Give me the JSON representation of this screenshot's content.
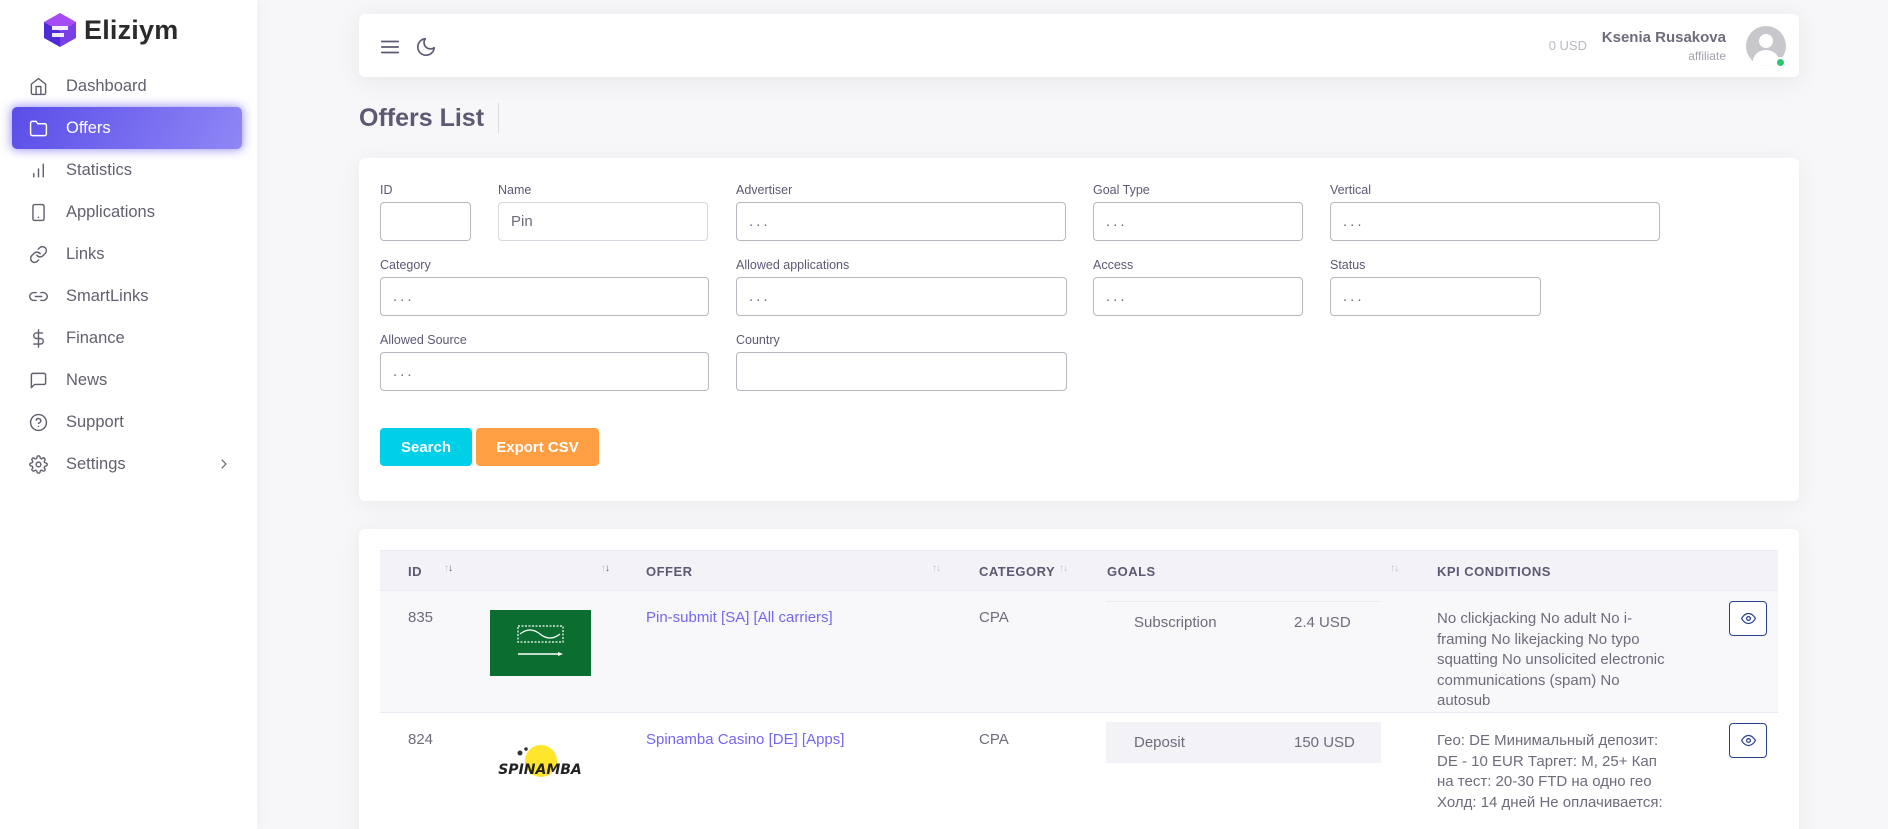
{
  "brand": {
    "name": "Eliziym",
    "colors": {
      "primary": "#7367f0",
      "logo_a": "#4d2bd8",
      "logo_b": "#a64bf4"
    }
  },
  "sidebar": {
    "items": [
      {
        "label": "Dashboard",
        "icon": "home-icon",
        "active": false
      },
      {
        "label": "Offers",
        "icon": "folder-icon",
        "active": true
      },
      {
        "label": "Statistics",
        "icon": "bar-chart-icon",
        "active": false
      },
      {
        "label": "Applications",
        "icon": "smartphone-icon",
        "active": false
      },
      {
        "label": "Links",
        "icon": "link-icon",
        "active": false
      },
      {
        "label": "SmartLinks",
        "icon": "link-2-icon",
        "active": false
      },
      {
        "label": "Finance",
        "icon": "dollar-icon",
        "active": false
      },
      {
        "label": "News",
        "icon": "message-square-icon",
        "active": false
      },
      {
        "label": "Support",
        "icon": "help-circle-icon",
        "active": false
      },
      {
        "label": "Settings",
        "icon": "settings-icon",
        "active": false,
        "has_submenu": true
      }
    ]
  },
  "topbar": {
    "balance": "0 USD",
    "user_name": "Ksenia Rusakova",
    "user_role": "affiliate",
    "status": "online"
  },
  "page": {
    "title": "Offers List"
  },
  "filters": {
    "id": {
      "label": "ID",
      "value": ""
    },
    "name": {
      "label": "Name",
      "value": "Pin"
    },
    "advertiser": {
      "label": "Advertiser",
      "placeholder": "..."
    },
    "goal_type": {
      "label": "Goal Type",
      "placeholder": "..."
    },
    "vertical": {
      "label": "Vertical",
      "placeholder": "..."
    },
    "category": {
      "label": "Category",
      "placeholder": "..."
    },
    "allowed_applications": {
      "label": "Allowed applications",
      "placeholder": "..."
    },
    "access": {
      "label": "Access",
      "placeholder": "..."
    },
    "status": {
      "label": "Status",
      "placeholder": "..."
    },
    "allowed_source": {
      "label": "Allowed Source",
      "placeholder": "..."
    },
    "country": {
      "label": "Country",
      "value": ""
    },
    "search_label": "Search",
    "export_label": "Export CSV"
  },
  "table": {
    "headers": {
      "id": "ID",
      "offer": "OFFER",
      "category": "CATEGORY",
      "goals": "GOALS",
      "kpi": "KPI CONDITIONS"
    },
    "rows": [
      {
        "id": "835",
        "image": "saudi-arabia-flag",
        "offer": "Pin-submit [SA] [All carriers]",
        "category": "CPA",
        "goal_name": "Subscription",
        "goal_payout": "2.4 USD",
        "kpi": "No clickjacking No adult No i-framing No likejacking No typo squatting No unsolicited electronic communications (spam) No autosub"
      },
      {
        "id": "824",
        "image": "spinamba-logo",
        "offer": "Spinamba Casino [DE] [Apps]",
        "category": "CPA",
        "goal_name": "Deposit",
        "goal_payout": "150 USD",
        "kpi": "Гео: DE Минимальный депозит: DE - 10 EUR Таргет: M, 25+ Кап на тест: 20-30 FTD на одно гео Холд: 14 дней Не оплачивается:"
      }
    ]
  }
}
